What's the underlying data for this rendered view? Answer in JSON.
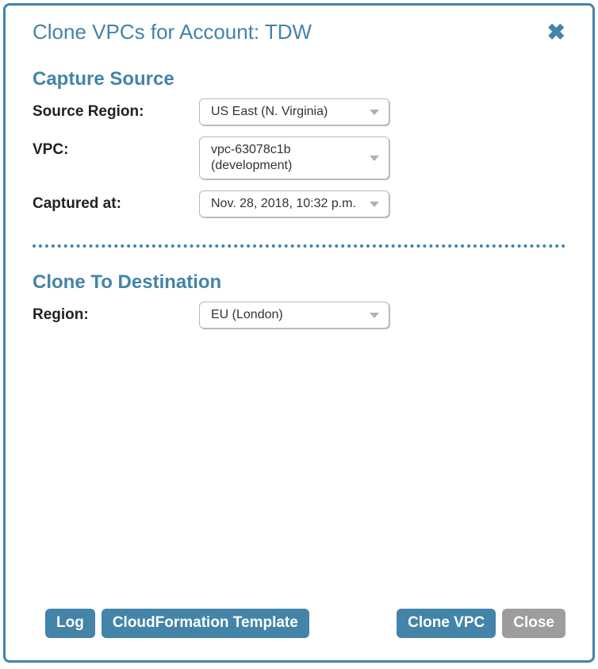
{
  "title": "Clone VPCs for Account: TDW",
  "sections": {
    "capture": {
      "title": "Capture Source",
      "source_region_label": "Source Region:",
      "source_region_value": "US East (N. Virginia)",
      "vpc_label": "VPC:",
      "vpc_value": "vpc-63078c1b (development)",
      "captured_at_label": "Captured at:",
      "captured_at_value": "Nov. 28, 2018, 10:32 p.m."
    },
    "destination": {
      "title": "Clone To Destination",
      "region_label": "Region:",
      "region_value": "EU (London)"
    }
  },
  "buttons": {
    "log": "Log",
    "cloudformation": "CloudFormation Template",
    "clone_vpc": "Clone VPC",
    "close": "Close"
  },
  "colors": {
    "accent": "#4384a8",
    "muted": "#9d9d9d"
  }
}
